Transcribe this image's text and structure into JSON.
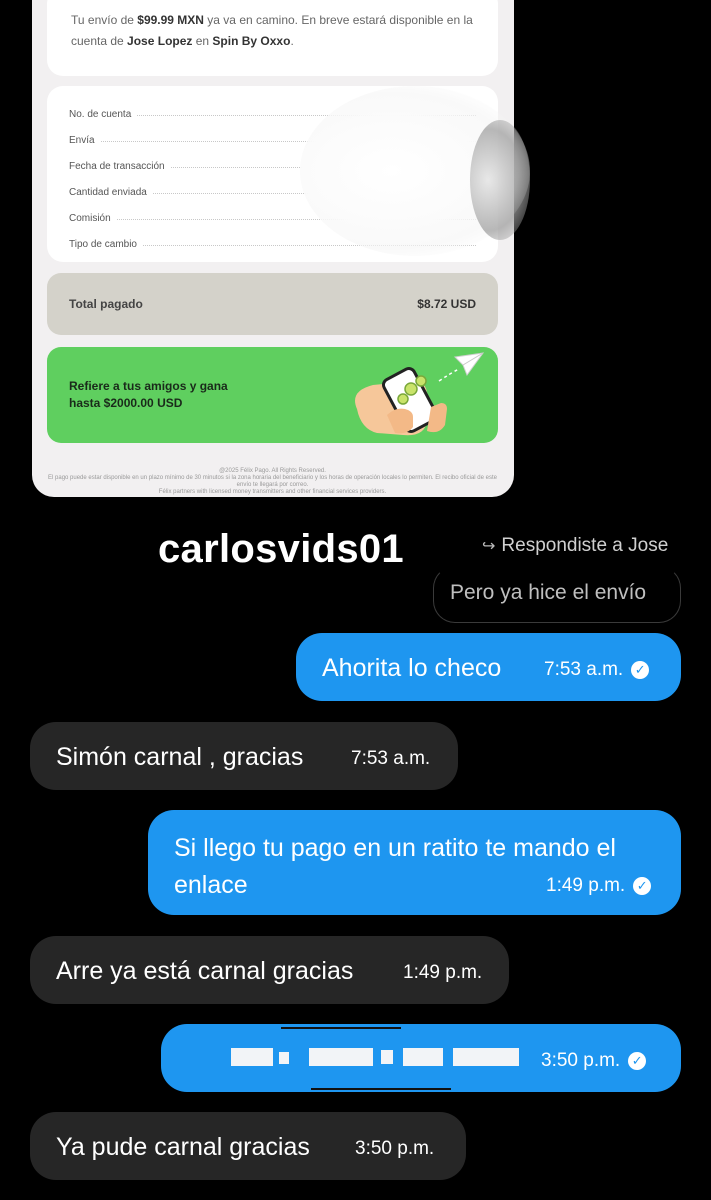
{
  "receipt": {
    "intro_prefix": "Tu envío de ",
    "amount": "$99.99 MXN",
    "intro_mid": " ya va en camino. En breve estará disponible en la cuenta de ",
    "recipient": "Jose Lopez",
    "intro_en": " en ",
    "provider": "Spin By Oxxo",
    "intro_end": ".",
    "details": [
      {
        "label": "No. de cuenta"
      },
      {
        "label": "Envía"
      },
      {
        "label": "Fecha de transacción"
      },
      {
        "label": "Cantidad enviada"
      },
      {
        "label": "Comisión"
      },
      {
        "label": "Tipo de cambio"
      }
    ],
    "total_label": "Total pagado",
    "total_value": "$8.72 USD",
    "promo_line1": "Refiere a tus amigos y gana",
    "promo_line2": "hasta $2000.00 USD",
    "footer_line1": "@2025 Félix Pago. All Rights Reserved.",
    "footer_line2": "El pago puede estar disponible en un plazo mínimo de 30 minutos si la zona horaria del beneficiario y los horas de operación locales lo permiten. El recibo oficial de este envío te llegará por correo.",
    "footer_line3": "Félix partners with licensed money transmitters and other financial services providers."
  },
  "chat": {
    "username": "carlosvids01",
    "reply_hint": "Respondiste a Jose",
    "quoted_text": "Pero ya hice el envío",
    "messages": [
      {
        "dir": "out",
        "text": "Ahorita lo checo",
        "time": "7:53 a.m."
      },
      {
        "dir": "in",
        "text": "Simón carnal , gracias",
        "time": "7:53 a.m."
      },
      {
        "dir": "out",
        "text": "Si llego tu pago en un ratito te mando el enlace",
        "time": "1:49 p.m."
      },
      {
        "dir": "in",
        "text": "Arre ya está carnal gracias",
        "time": "1:49 p.m."
      },
      {
        "dir": "out",
        "text": "",
        "time": "3:50 p.m."
      },
      {
        "dir": "in",
        "text": "Ya pude carnal gracias",
        "time": "3:50 p.m."
      }
    ]
  },
  "colors": {
    "outgoing_bubble": "#1e96f0",
    "incoming_bubble": "#262626",
    "promo_green": "#5fcf5f",
    "total_panel": "#d4d2ca"
  }
}
